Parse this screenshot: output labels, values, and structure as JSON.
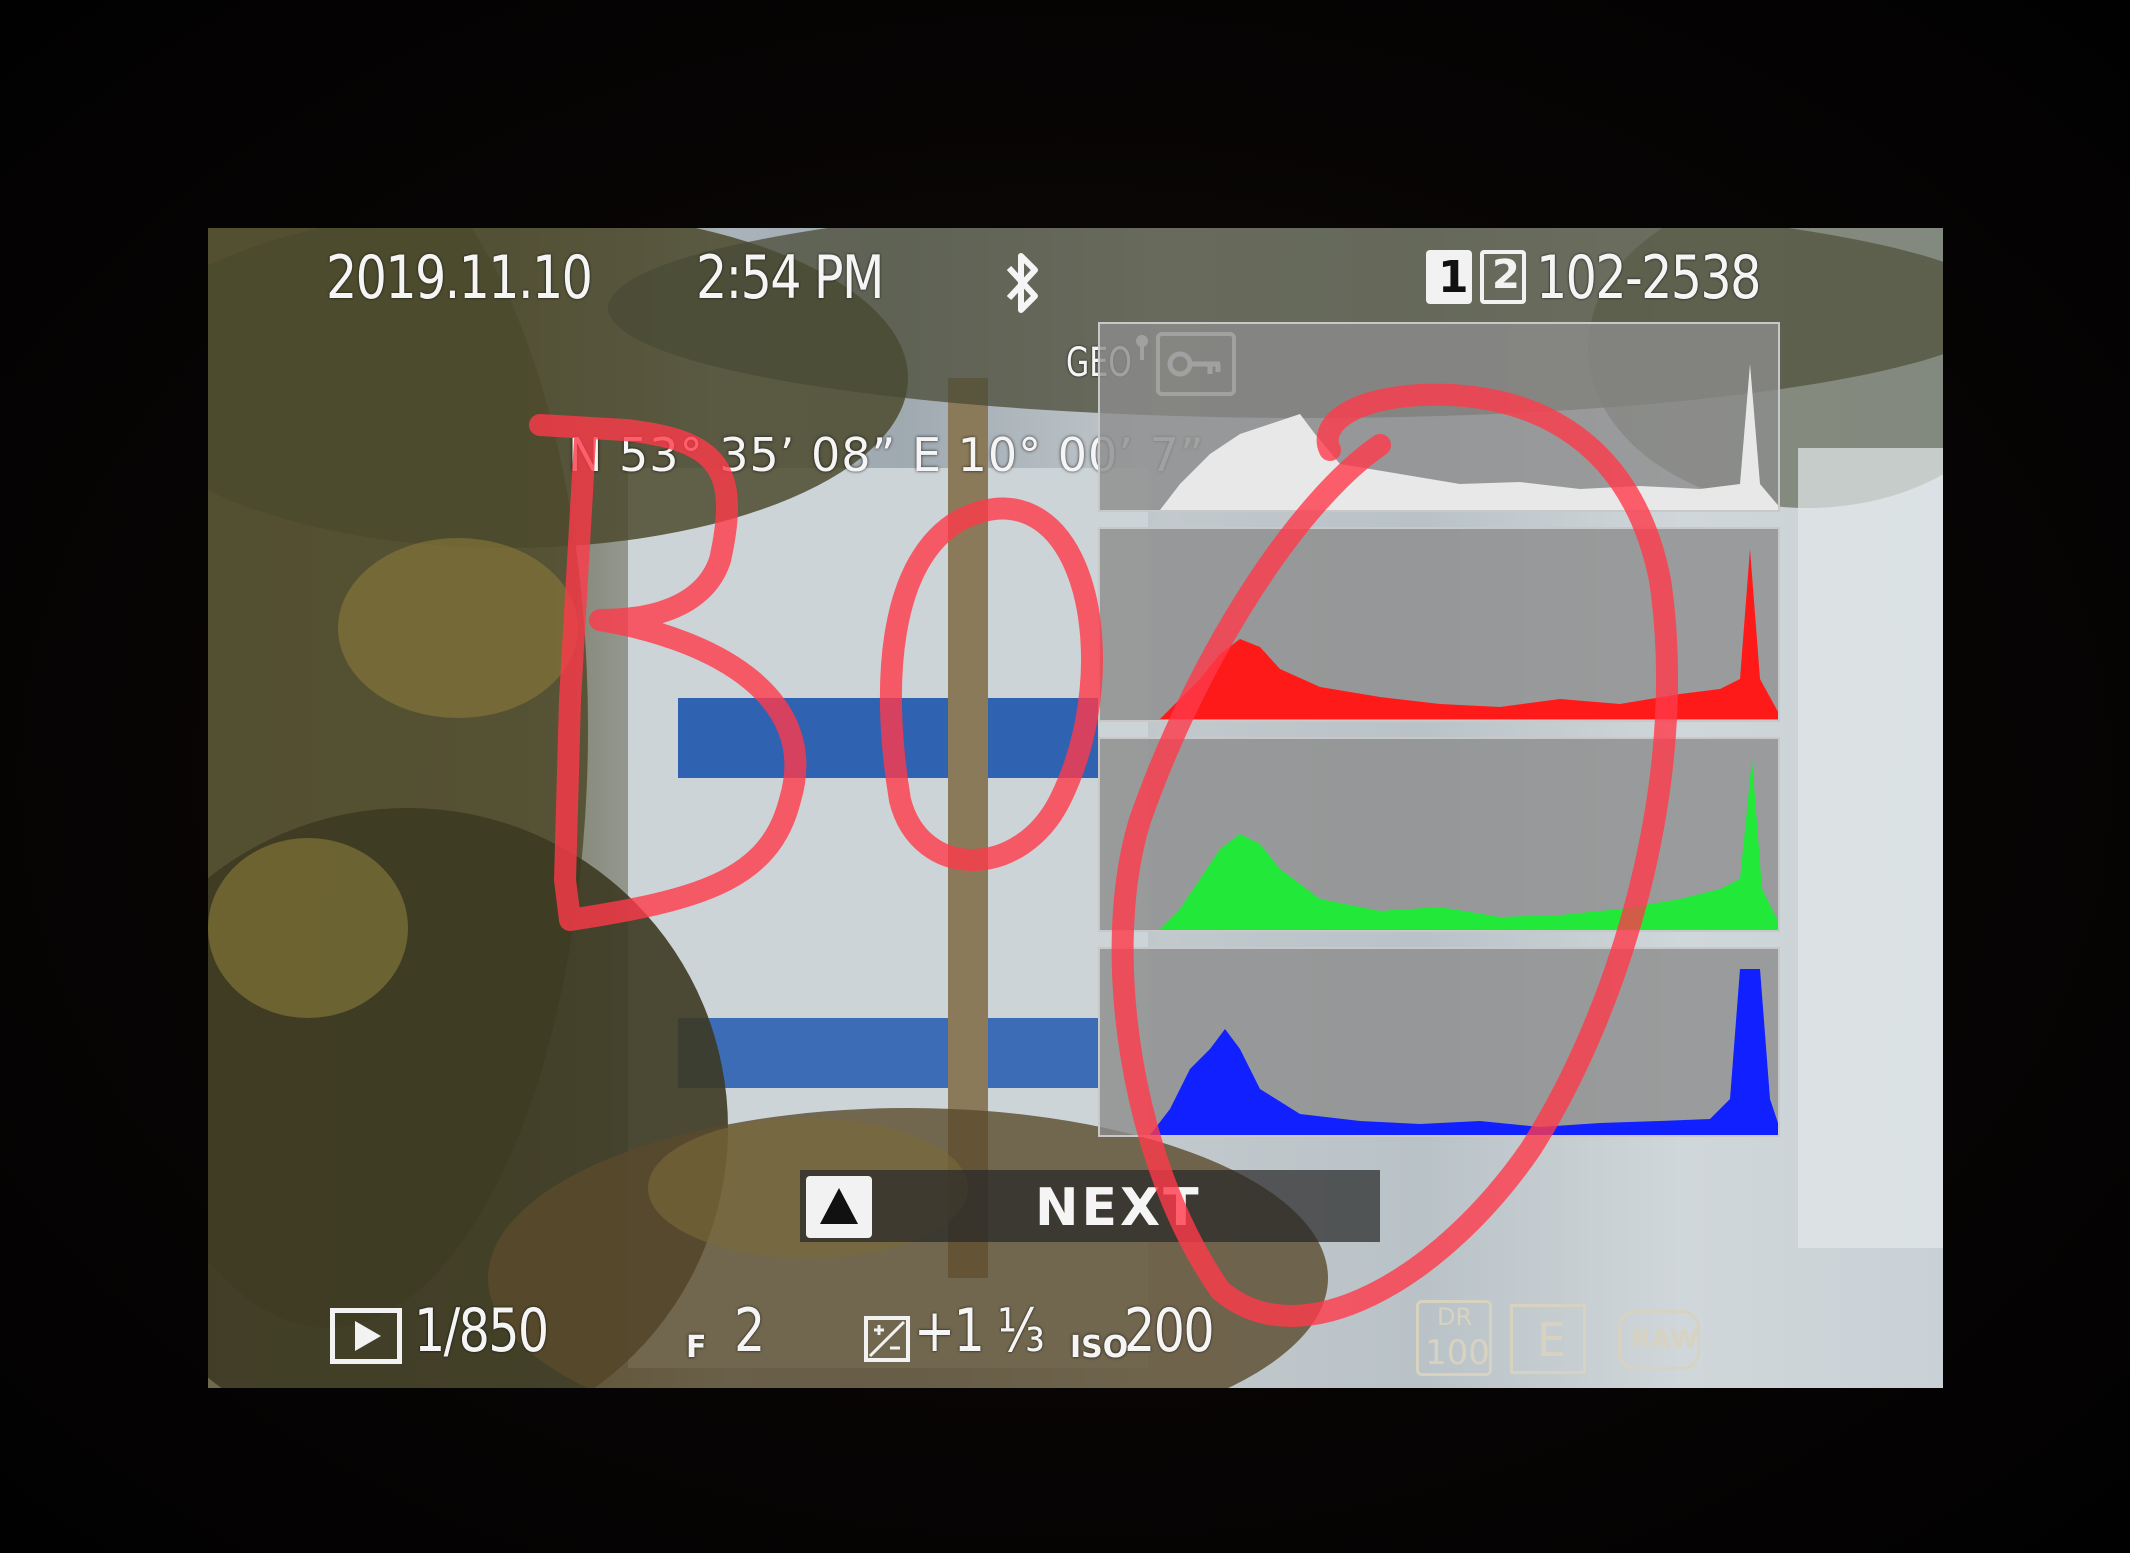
{
  "header": {
    "date": "2019.11.10",
    "time": "2:54 PM",
    "card_slot_1": "1",
    "card_slot_2": "2",
    "file_number": "102-2538"
  },
  "location": {
    "geo_label": "GEO",
    "coordinates": "N  53° 35’ 08”  E  10° 00’ 7”"
  },
  "footer": {
    "frame_counter": "1/850",
    "aperture_prefix": "F",
    "aperture": "2",
    "exposure_comp": "+1 ⅓",
    "iso_label": "ISO",
    "iso": "200",
    "dr_label": "DR",
    "dr_value": "100",
    "film_sim": "E",
    "format": "RAW"
  },
  "navigation": {
    "next_label": "NEXT"
  },
  "annotation": {
    "handwritten": "BO"
  },
  "colors": {
    "hist_luma": "#e8e8e8",
    "hist_red": "#ff1a1a",
    "hist_green": "#22e83a",
    "hist_blue": "#1020ff",
    "annotation": "#ff3a4a"
  },
  "icons": [
    "bluetooth-icon",
    "sd-slot-1-icon",
    "sd-slot-2-icon",
    "geo-icon",
    "protect-key-icon",
    "playback-icon",
    "exposure-comp-icon",
    "up-arrow-icon"
  ]
}
